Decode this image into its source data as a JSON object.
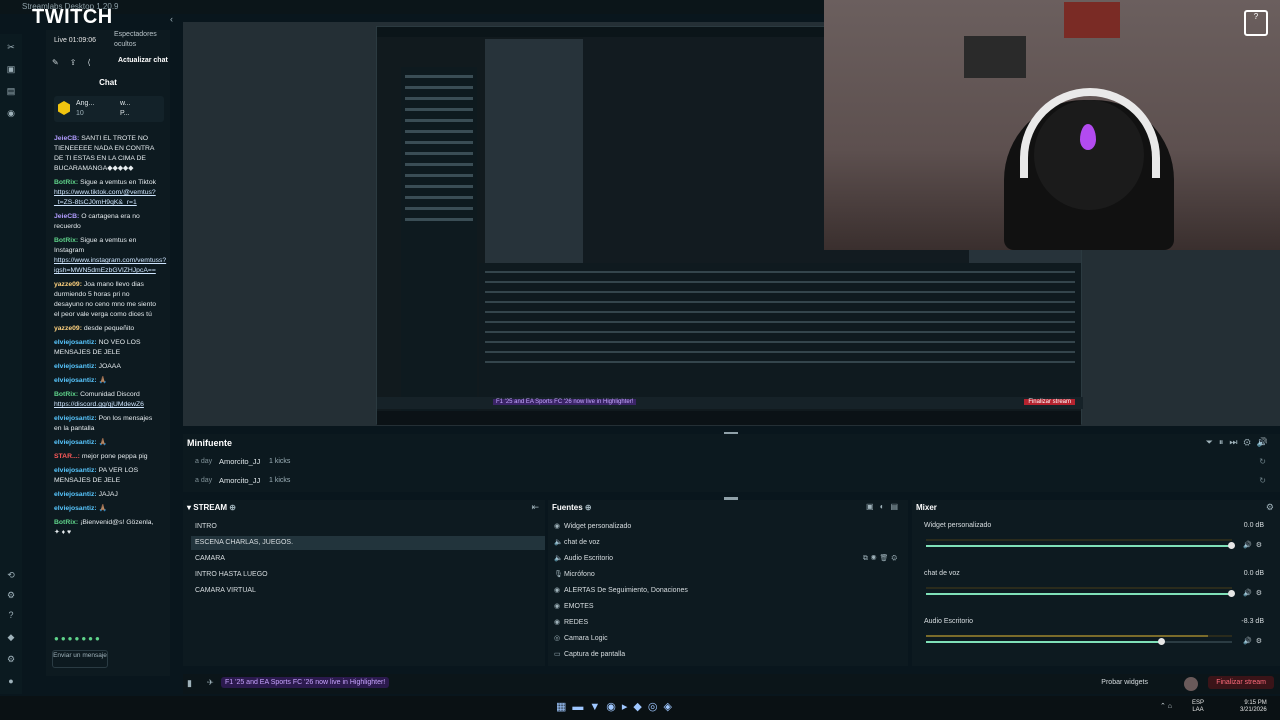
{
  "window": {
    "title": "Streamlabs Desktop 1.20.9",
    "logo_text": "TWITCH"
  },
  "chat": {
    "live_label": "Live 01:09:06",
    "viewers_label": "Espectadores ocultos",
    "refresh_label": "Actualizar chat",
    "title": "Chat",
    "pinned": {
      "name": "Ang...",
      "count": "10",
      "w": "w...",
      "w_count": "3",
      "p": "P...",
      "p_count": "2"
    },
    "messages": [
      {
        "user": "JeieCB:",
        "color": "#b19cff",
        "text": "SANTI EL TROTE NO TIENEEEEE NADA EN CONTRA DE TI ESTAS EN LA CIMA DE BUCARAMANGA◆◆◆◆◆"
      },
      {
        "user": "BotRix:",
        "color": "#5fd38a",
        "text": "Sigue a vemtus en Tiktok",
        "link": "https://www.tiktok.com/@vemtus?_t=ZS-8tsCJ0mH9qK&_r=1"
      },
      {
        "user": "JeieCB:",
        "color": "#b19cff",
        "text": "O cartagena era no recuerdo"
      },
      {
        "user": "BotRix:",
        "color": "#5fd38a",
        "text": "Sigue a vemtus en Instagram",
        "link": "https://www.instagram.com/vemtuss?igsh=MWN5dmEzbGVlZHJpcA=="
      },
      {
        "user": "yazze09:",
        "color": "#ffd27f",
        "text": "Joa mano llevo dias durmiendo 5 horas pri no desayuno no ceno mno me siento el peor vale verga como dices tú"
      },
      {
        "user": "yazze09:",
        "color": "#ffd27f",
        "text": "desde pequeñito"
      },
      {
        "user": "elviejosantiz:",
        "color": "#58c7ff",
        "text": "NO VEO LOS MENSAJES DE JELE"
      },
      {
        "user": "elviejosantiz:",
        "color": "#58c7ff",
        "text": "JOAAA"
      },
      {
        "user": "elviejosantiz:",
        "color": "#58c7ff",
        "text": "🙏🏽"
      },
      {
        "user": "BotRix:",
        "color": "#5fd38a",
        "text": "Comunidad Discord",
        "link": "https://discord.gg/qjUMdewZ6"
      },
      {
        "user": "elviejosantiz:",
        "color": "#58c7ff",
        "text": "Pon los mensajes en la pantalla"
      },
      {
        "user": "elviejosantiz:",
        "color": "#58c7ff",
        "text": "🙏🏽"
      },
      {
        "user": "STAR...:",
        "color": "#ff5a5a",
        "text": "mejor pone peppa pig"
      },
      {
        "user": "elviejosantiz:",
        "color": "#58c7ff",
        "text": "PA VER LOS MENSAJES DE JELE"
      },
      {
        "user": "elviejosantiz:",
        "color": "#58c7ff",
        "text": "JAJAJ"
      },
      {
        "user": "elviejosantiz:",
        "color": "#58c7ff",
        "text": "🙏🏽"
      },
      {
        "user": "BotRix:",
        "color": "#5fd38a",
        "text": "¡Bienvenid@s! Gözenla, ✦ ♦ ♥"
      }
    ],
    "input_placeholder": "Enviar un mensaje"
  },
  "minifuente": {
    "title": "Minifuente",
    "events": [
      {
        "ago": "a day",
        "user": "Amorcito_JJ",
        "kicks": "1 kicks"
      },
      {
        "ago": "a day",
        "user": "Amorcito_JJ",
        "kicks": "1 kicks"
      }
    ]
  },
  "stream": {
    "title": "STREAM",
    "scenes": [
      "INTRO",
      "ESCENA CHARLAS, JUEGOS.",
      "CAMARA",
      "INTRO HASTA LUEGO",
      "CAMARA VIRTUAL"
    ],
    "selected": 1
  },
  "sources": {
    "title": "Fuentes",
    "items": [
      {
        "label": "Widget personalizado",
        "icon": "widget-icon"
      },
      {
        "label": "chat de voz",
        "icon": "speaker-icon"
      },
      {
        "label": "Audio Escritorio",
        "icon": "speaker-icon"
      },
      {
        "label": "Micrófono",
        "icon": "mic-icon"
      },
      {
        "label": "ALERTAS De Seguimiento, Donaciones",
        "icon": "widget-icon"
      },
      {
        "label": "EMOTES",
        "icon": "widget-icon"
      },
      {
        "label": "REDES",
        "icon": "widget-icon"
      },
      {
        "label": "Camara Logic",
        "icon": "camera-icon"
      },
      {
        "label": "Captura de pantalla",
        "icon": "monitor-icon"
      }
    ]
  },
  "mixer": {
    "title": "Mixer",
    "channels": [
      {
        "label": "Widget personalizado",
        "db": "0.0 dB",
        "level": 1.0,
        "meter": 0
      },
      {
        "label": "chat de voz",
        "db": "0.0 dB",
        "level": 1.0,
        "meter": 0
      },
      {
        "label": "Audio Escritorio",
        "db": "-8.3 dB",
        "level": 0.77,
        "meter": 0.92
      }
    ]
  },
  "footer": {
    "ad_text": "F1 '25 and EA Sports FC '26 now live in Highlighter!",
    "test_widgets": "Probar widgets",
    "end_stream": "Finalizar stream"
  },
  "taskbar": {
    "lang_top": "ESP",
    "lang_bottom": "LAA",
    "time": "9:15 PM",
    "date": "3/21/2026"
  },
  "colors": {
    "accent": "#7fe0b8",
    "danger": "#ff6b7b",
    "panel": "#0d1a20"
  }
}
